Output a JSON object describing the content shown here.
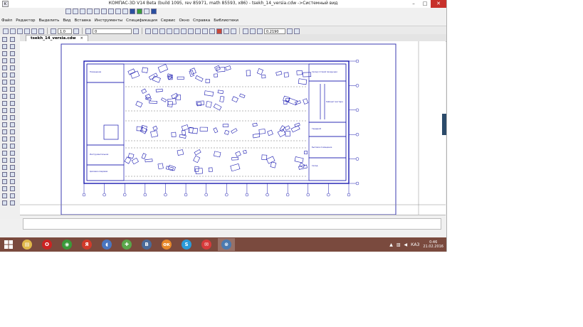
{
  "window": {
    "title": "КОМПАС-3D V14 Beta (build 1095, rev 85971, math 85593, x86) - tsekh_14_versia.cdw ->Системный вид",
    "btn_minimize": "–",
    "btn_maximize": "□",
    "btn_close": "✕"
  },
  "menu": [
    "Файл",
    "Редактор",
    "Выделить",
    "Вид",
    "Вставка",
    "Инструменты",
    "Спецификация",
    "Сервис",
    "Окно",
    "Справка",
    "Библиотеки"
  ],
  "toolbar": {
    "line_step": "1.0",
    "layer": "0",
    "zoom": "0.2190"
  },
  "document_tab": {
    "label": "tsekh_14_versia.cdw",
    "close": "×"
  },
  "drawing": {
    "rooms": [
      "Помещение",
      "Цеховая кладовая",
      "Инструментальная",
      "Кабинет мастера",
      "Гардероб",
      "Бытовое помещение",
      "Склад",
      "Склад готовой продукции"
    ]
  },
  "taskbar": {
    "apps": [
      {
        "icon": "file-explorer-icon",
        "glyph": "▤",
        "color": "#e0b84a"
      },
      {
        "icon": "opera-icon",
        "glyph": "O",
        "color": "#cc2222"
      },
      {
        "icon": "chrome-icon",
        "glyph": "◉",
        "color": "#3a9a3a"
      },
      {
        "icon": "yandex-icon",
        "glyph": "Я",
        "color": "#d23a2a"
      },
      {
        "icon": "media-player-icon",
        "glyph": "◖",
        "color": "#4a76c0"
      },
      {
        "icon": "torrent-icon",
        "glyph": "✚",
        "color": "#5aa64a"
      },
      {
        "icon": "vk-icon",
        "glyph": "В",
        "color": "#4a6a9a"
      },
      {
        "icon": "odnoklassniki-icon",
        "glyph": "ок",
        "color": "#e8892a"
      },
      {
        "icon": "skype-icon",
        "glyph": "S",
        "color": "#2a9ad8"
      },
      {
        "icon": "mail-icon",
        "glyph": "✉",
        "color": "#d83a3a"
      },
      {
        "icon": "kompas-icon",
        "glyph": "⊗",
        "color": "#4a7ab0"
      }
    ],
    "language": "КАЗ",
    "time": "0:46",
    "date": "21.02.2016"
  }
}
